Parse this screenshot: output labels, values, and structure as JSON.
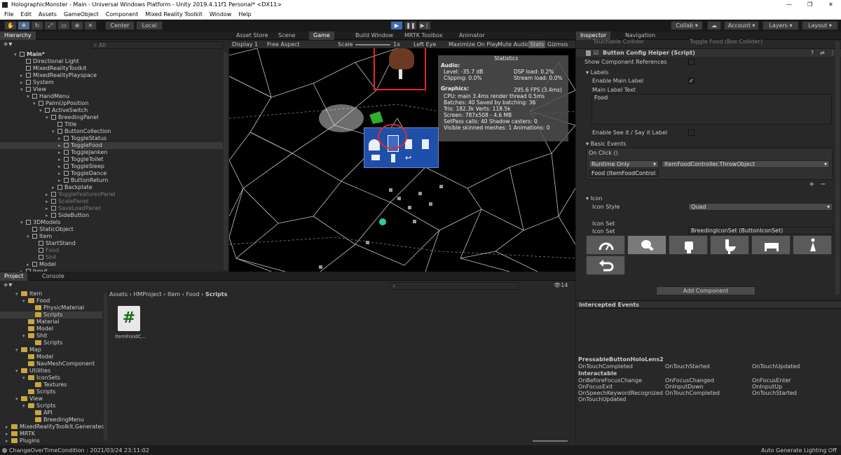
{
  "window": {
    "title": "HolographicMonster - Main - Universal Windows Platform - Unity 2019.4.11f1 Personal* <DX11>"
  },
  "menu": [
    "File",
    "Edit",
    "Assets",
    "GameObject",
    "Component",
    "Mixed Reality Toolkit",
    "Window",
    "Help"
  ],
  "toolbar": {
    "center": "Center",
    "local": "Local",
    "collab": "Collab",
    "account": "Account",
    "layers": "Layers",
    "layout": "Layout"
  },
  "hierarchy": {
    "tab": "Hierarchy",
    "search_placeholder": "All",
    "items": [
      {
        "label": "Main*",
        "depth": 0,
        "type": "scene",
        "style": ""
      },
      {
        "label": "Directional Light",
        "depth": 1,
        "type": "obj",
        "style": ""
      },
      {
        "label": "MixedRealityToolkit",
        "depth": 1,
        "type": "obj",
        "style": ""
      },
      {
        "label": "MixedRealityPlayspace",
        "depth": 1,
        "type": "obj",
        "style": "arrow"
      },
      {
        "label": "System",
        "depth": 1,
        "type": "obj",
        "style": "arrow"
      },
      {
        "label": "View",
        "depth": 1,
        "type": "obj",
        "style": "open"
      },
      {
        "label": "HandMenu",
        "depth": 2,
        "type": "obj",
        "style": "open"
      },
      {
        "label": "PalmUpPosition",
        "depth": 3,
        "type": "obj",
        "style": "open"
      },
      {
        "label": "ActiveSwitch",
        "depth": 4,
        "type": "obj",
        "style": "open"
      },
      {
        "label": "BreedingPanel",
        "depth": 5,
        "type": "obj",
        "style": "open"
      },
      {
        "label": "Title",
        "depth": 6,
        "type": "obj",
        "style": ""
      },
      {
        "label": "ButtonCollection",
        "depth": 6,
        "type": "obj",
        "style": "open"
      },
      {
        "label": "ToggleStatus",
        "depth": 7,
        "type": "obj",
        "style": "arrow"
      },
      {
        "label": "ToggleFood",
        "depth": 7,
        "type": "obj",
        "style": "arrow sel"
      },
      {
        "label": "ToggleJanken",
        "depth": 7,
        "type": "obj",
        "style": "arrow"
      },
      {
        "label": "ToggleToilet",
        "depth": 7,
        "type": "obj",
        "style": "arrow"
      },
      {
        "label": "ToggleSleep",
        "depth": 7,
        "type": "obj",
        "style": "arrow"
      },
      {
        "label": "ToggleDance",
        "depth": 7,
        "type": "obj",
        "style": "arrow"
      },
      {
        "label": "ButtonReturn",
        "depth": 7,
        "type": "obj",
        "style": "arrow"
      },
      {
        "label": "Backplate",
        "depth": 6,
        "type": "obj",
        "style": "arrow"
      },
      {
        "label": "ToggleFeaturesPanel",
        "depth": 5,
        "type": "obj",
        "style": "arrow gray"
      },
      {
        "label": "ScalePanel",
        "depth": 5,
        "type": "obj",
        "style": "arrow gray"
      },
      {
        "label": "SaveLoadPanel",
        "depth": 5,
        "type": "obj",
        "style": "arrow gray"
      },
      {
        "label": "SideButton",
        "depth": 5,
        "type": "obj",
        "style": "arrow"
      },
      {
        "label": "3DModels",
        "depth": 1,
        "type": "obj",
        "style": "open"
      },
      {
        "label": "StaticObject",
        "depth": 2,
        "type": "obj",
        "style": ""
      },
      {
        "label": "Item",
        "depth": 2,
        "type": "obj",
        "style": "open"
      },
      {
        "label": "StartStand",
        "depth": 3,
        "type": "obj",
        "style": ""
      },
      {
        "label": "Food",
        "depth": 3,
        "type": "obj",
        "style": "gray"
      },
      {
        "label": "Shit",
        "depth": 3,
        "type": "obj",
        "style": "gray"
      },
      {
        "label": "Model",
        "depth": 2,
        "type": "obj",
        "style": "arrow"
      },
      {
        "label": "Input",
        "depth": 1,
        "type": "obj",
        "style": "arrow"
      }
    ]
  },
  "scene_tabs": [
    "Asset Store",
    "Scene",
    "Game",
    "Build Window",
    "MRTK Toolbox",
    "Animator"
  ],
  "game_bar": {
    "display": "Display 1",
    "aspect": "Free Aspect",
    "scale": "Scale",
    "scale_val": "1x",
    "eye": "Left Eye",
    "maximize": "Maximize On Play",
    "mute": "Mute Audio",
    "stats": "Stats",
    "gizmos": "Gizmos"
  },
  "stats": {
    "title": "Statistics",
    "audio": "Audio:",
    "level": "Level: -35.7 dB",
    "clipping": "Clipping: 0.0%",
    "dsp": "DSP load: 0.2%",
    "stream": "Stream load: 0.0%",
    "graphics": "Graphics:",
    "fps": "295.6 FPS (3.4ms)",
    "cpu": "CPU: main 3.4ms  render thread 0.5ms",
    "batches": "Batches: 40    Saved by batching: 36",
    "tris": "Tris: 182.3k    Verts: 118.5k",
    "screen": "Screen: 787x508 - 4.6 MB",
    "setpass": "SetPass calls: 40       Shadow casters: 0",
    "skinned": "Visible skinned meshes: 1  Animations: 0"
  },
  "inspector": {
    "tabs": [
      "Inspector",
      "Navigation"
    ],
    "prev_component": "Touchable Collider",
    "prev_value": "Toggle Food (Box Collider)",
    "component": "Button Config Helper (Script)",
    "show_refs": "Show Component References",
    "labels_header": "Labels",
    "enable_main": "Enable Main Label",
    "main_label_text": "Main Label Text",
    "main_label_value": "Food",
    "enable_see_it": "Enable See it / Say it Label",
    "basic_events": "Basic Events",
    "on_click": "On Click ()",
    "runtime": "Runtime Only",
    "function": "ItemFoodController.ThrowObject",
    "target": "Food (ItemFoodControl",
    "plus": "+",
    "minus": "−",
    "icon_header": "Icon",
    "icon_style": "Icon Style",
    "icon_style_val": "Quad",
    "icon_set_header": "Icon Set",
    "icon_set": "Icon Set",
    "icon_set_val": "BreedingIconSet (ButtonIconSet)",
    "icons": [
      "gauge-icon",
      "meat-icon",
      "fist-icon",
      "toilet-icon",
      "bed-icon",
      "dancer-icon",
      "return-icon"
    ],
    "add_component": "Add Component",
    "intercepted": "Intercepted Events",
    "pressable": "PressableButtonHoloLens2",
    "interactable": "Interactable",
    "events_a": [
      [
        "OnTouchCompleted",
        "OnTouchStarted",
        "OnTouchUpdated"
      ]
    ],
    "events_b": [
      [
        "OnBeforeFocusChange",
        "OnFocusChanged",
        "OnFocusEnter"
      ],
      [
        "OnFocusExit",
        "OnInputDown",
        "OnInputUp"
      ],
      [
        "OnSpeechKeywordRecognized",
        "OnTouchCompleted",
        "OnTouchStarted"
      ],
      [
        "OnTouchUpdated",
        "",
        ""
      ]
    ]
  },
  "project": {
    "tabs": [
      "Project",
      "Console"
    ],
    "tree": [
      {
        "label": "Item",
        "depth": 0,
        "open": true,
        "sel": false
      },
      {
        "label": "Food",
        "depth": 1,
        "open": true,
        "sel": false
      },
      {
        "label": "PhysicMaterial",
        "depth": 2,
        "open": false,
        "sel": false
      },
      {
        "label": "Scripts",
        "depth": 2,
        "open": false,
        "sel": true
      },
      {
        "label": "Material",
        "depth": 1,
        "open": false,
        "sel": false
      },
      {
        "label": "Model",
        "depth": 1,
        "open": false,
        "sel": false
      },
      {
        "label": "Shit",
        "depth": 1,
        "open": true,
        "sel": false
      },
      {
        "label": "Scripts",
        "depth": 2,
        "open": false,
        "sel": false
      },
      {
        "label": "Map",
        "depth": 0,
        "open": true,
        "sel": false
      },
      {
        "label": "Model",
        "depth": 1,
        "open": false,
        "sel": false
      },
      {
        "label": "NavMeshComponent",
        "depth": 1,
        "open": false,
        "sel": false
      },
      {
        "label": "Utilities",
        "depth": 0,
        "open": true,
        "sel": false
      },
      {
        "label": "IconSets",
        "depth": 1,
        "open": true,
        "sel": false
      },
      {
        "label": "Textures",
        "depth": 2,
        "open": false,
        "sel": false
      },
      {
        "label": "Scripts",
        "depth": 1,
        "open": false,
        "sel": false
      },
      {
        "label": "View",
        "depth": 0,
        "open": true,
        "sel": false
      },
      {
        "label": "Scripts",
        "depth": 1,
        "open": true,
        "sel": false
      },
      {
        "label": "API",
        "depth": 2,
        "open": false,
        "sel": false
      },
      {
        "label": "BreedingMenu",
        "depth": 2,
        "open": false,
        "sel": false
      },
      {
        "label": "MixedRealityToolkit.Generated",
        "depth": -1,
        "open": false,
        "sel": false
      },
      {
        "label": "MRTK",
        "depth": -1,
        "open": false,
        "sel": false
      },
      {
        "label": "Plugins",
        "depth": -1,
        "open": false,
        "sel": false
      }
    ],
    "breadcrumb": [
      "Assets",
      "HMProject",
      "Item",
      "Food",
      "Scripts"
    ],
    "asset_name": "ItemFoodC...",
    "asset_glyph": "#",
    "count": "14"
  },
  "status": {
    "left": "ChangeOverTimeCondition : 2021/03/24 23:11:02",
    "right": "Auto Generate Lighting Off"
  }
}
